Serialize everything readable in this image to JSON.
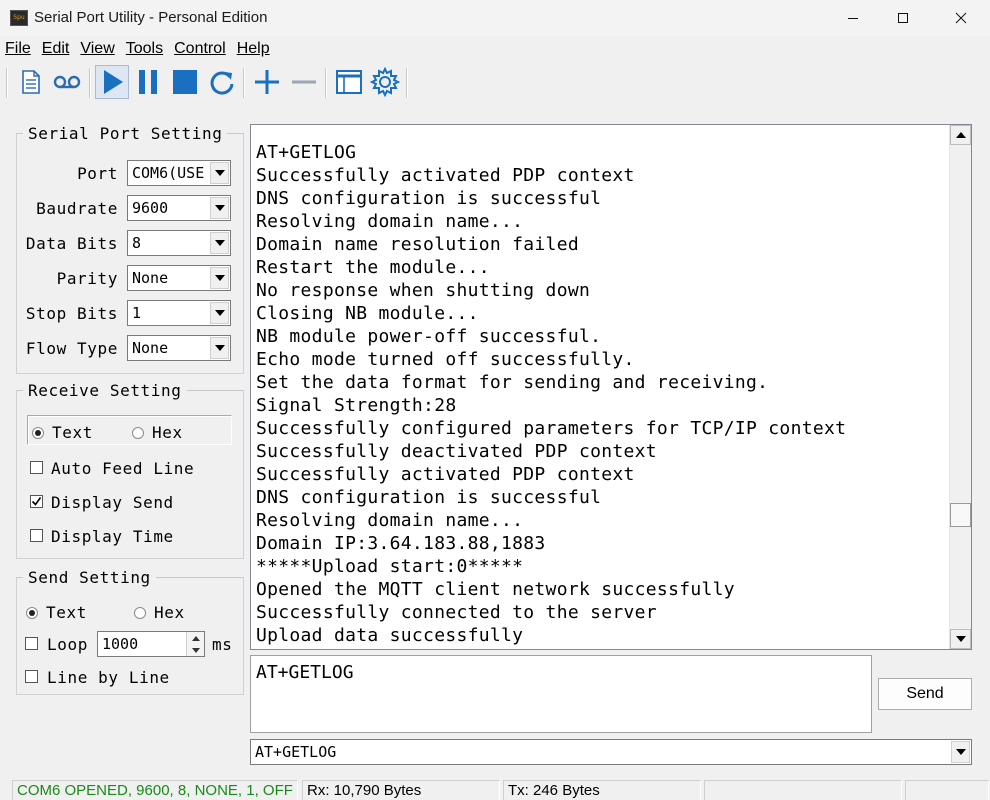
{
  "window": {
    "title": "Serial Port Utility - Personal Edition",
    "icon_text": "Spu",
    "controls": [
      "minimize-icon",
      "maximize-icon",
      "close-icon"
    ]
  },
  "menu": [
    {
      "label": "File",
      "key": "F"
    },
    {
      "label": "Edit",
      "key": "E"
    },
    {
      "label": "View",
      "key": "V"
    },
    {
      "label": "Tools",
      "key": "T"
    },
    {
      "label": "Control",
      "key": "C"
    },
    {
      "label": "Help",
      "key": "H"
    }
  ],
  "toolbar": {
    "buttons": [
      "new-document-icon",
      "record-icon",
      "start-icon",
      "pause-icon",
      "stop-icon",
      "refresh-icon",
      "add-icon",
      "remove-icon",
      "window-icon",
      "settings-icon"
    ],
    "accent_color": "#1a6fc0"
  },
  "serial_port": {
    "legend": "Serial Port Setting",
    "port_label": "Port",
    "port_value": "COM6(USE",
    "baudrate_label": "Baudrate",
    "baudrate_value": "9600",
    "databits_label": "Data Bits",
    "databits_value": "8",
    "parity_label": "Parity",
    "parity_value": "None",
    "stopbits_label": "Stop Bits",
    "stopbits_value": "1",
    "flow_label": "Flow Type",
    "flow_value": "None"
  },
  "receive": {
    "legend": "Receive Setting",
    "text_label": "Text",
    "hex_label": "Hex",
    "selected": "Text",
    "auto_feed_label": "Auto Feed Line",
    "auto_feed_checked": false,
    "display_send_label": "Display Send",
    "display_send_checked": true,
    "display_time_label": "Display Time",
    "display_time_checked": false
  },
  "send_setting": {
    "legend": "Send Setting",
    "text_label": "Text",
    "hex_label": "Hex",
    "selected": "Text",
    "loop_label": "Loop",
    "loop_checked": false,
    "loop_value": "1000",
    "loop_unit": "ms",
    "line_by_line_label": "Line by Line",
    "line_by_line_checked": false
  },
  "output_lines": [
    "AT+GETLOG",
    "Successfully activated PDP context",
    "DNS configuration is successful",
    "Resolving domain name...",
    "Domain name resolution failed",
    "Restart the module...",
    "No response when shutting down",
    "Closing NB module...",
    "NB module power-off successful.",
    "Echo mode turned off successfully.",
    "Set the data format for sending and receiving.",
    "Signal Strength:28",
    "Successfully configured parameters for TCP/IP context",
    "Successfully deactivated PDP context",
    "Successfully activated PDP context",
    "DNS configuration is successful",
    "Resolving domain name...",
    "Domain IP:3.64.183.88,1883",
    "*****Upload start:0*****",
    "Opened the MQTT client network successfully",
    "Successfully connected to the server",
    "Upload data successfully"
  ],
  "send_area": {
    "text": "AT+GETLOG",
    "button_label": "Send",
    "history_value": "AT+GETLOG"
  },
  "status": {
    "connection": "COM6 OPENED, 9600, 8, NONE, 1, OFF",
    "connection_color": "#1a8a1a",
    "rx": "Rx: 10,790 Bytes",
    "tx": "Tx: 246 Bytes"
  }
}
